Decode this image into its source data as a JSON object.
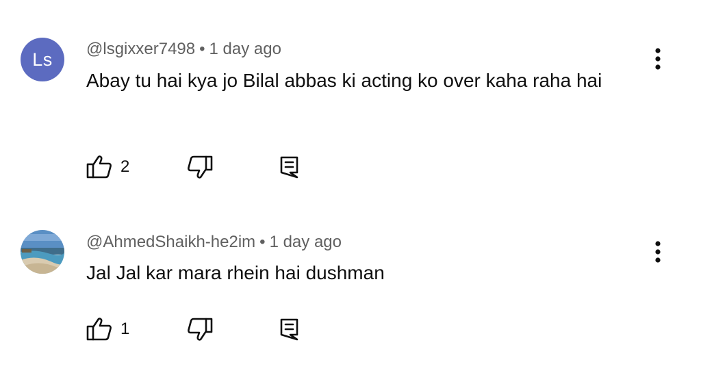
{
  "comments": [
    {
      "avatar_text": "Ls",
      "avatar_color": "#5c6bc0",
      "handle": "@lsgixxer7498",
      "separator": "•",
      "time": "1 day ago",
      "text": "Abay tu hai kya jo Bilal abbas ki acting ko over kaha raha hai",
      "likes": "2",
      "like_icon": "thumbs-up-icon",
      "dislike_icon": "thumbs-down-icon",
      "reply_icon": "reply-icon",
      "more_icon": "more-vertical-icon"
    },
    {
      "avatar_image": "beach-landscape",
      "handle": "@AhmedShaikh-he2im",
      "separator": "•",
      "time": "1 day ago",
      "text": "Jal Jal kar mara rhein hai dushman",
      "likes": "1",
      "like_icon": "thumbs-up-icon",
      "dislike_icon": "thumbs-down-icon",
      "reply_icon": "reply-icon",
      "more_icon": "more-vertical-icon"
    }
  ]
}
